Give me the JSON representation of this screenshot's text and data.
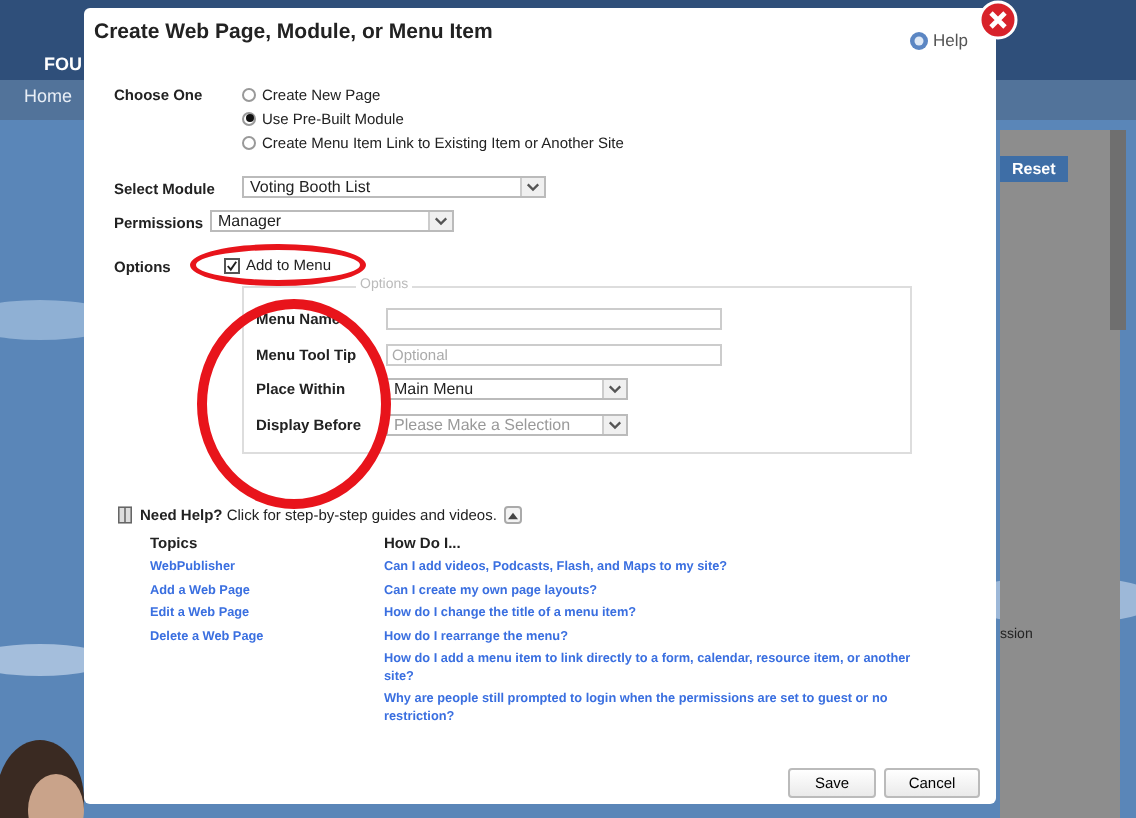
{
  "background": {
    "logo_text": "FOU",
    "nav": [
      "Home"
    ],
    "reset_button": "Reset",
    "fragment": "ssion"
  },
  "dialog": {
    "title": "Create Web Page, Module, or Menu Item",
    "help": "Help",
    "choose_one": {
      "label": "Choose One",
      "options": [
        {
          "label": "Create New Page",
          "selected": false
        },
        {
          "label": "Use Pre-Built Module",
          "selected": true
        },
        {
          "label": "Create Menu Item Link to Existing Item or Another Site",
          "selected": false
        }
      ]
    },
    "selects": [
      {
        "label": "Select Module",
        "value": "Voting Booth List"
      },
      {
        "label": "Permissions",
        "value": "Manager"
      }
    ],
    "options": {
      "label": "Options",
      "add_to_menu": {
        "label": "Add to Menu",
        "checked": true
      }
    },
    "menu_options": {
      "legend": "Options",
      "fields": [
        {
          "label": "Menu Name",
          "kind": "text"
        },
        {
          "label": "Menu Tool Tip",
          "kind": "text",
          "placeholder": "Optional"
        },
        {
          "label": "Place Within",
          "kind": "select",
          "value": "Main Menu"
        },
        {
          "label": "Display Before",
          "kind": "select",
          "placeholder": "Please Make a Selection"
        }
      ]
    },
    "need_help": {
      "text": "**Need Help?** Click for step-by-step guides and videos.",
      "topics_heading": "Topics",
      "topics": [
        "WebPublisher",
        "Add a Web Page",
        "Edit a Web Page",
        "Delete a Web Page"
      ],
      "how_heading": "How Do I...",
      "questions": [
        "Can I add videos, Podcasts, Flash, and Maps to my site?",
        "Can I create my own page layouts?",
        "How do I change the title of a menu item?",
        "How do I rearrange the menu?",
        "How do I add a menu item to link directly to a form, calendar, resource item, or another site?",
        "Why are people still prompted to login when the permissions are set to guest or no restriction?"
      ]
    },
    "buttons": [
      "Save",
      "Cancel"
    ]
  }
}
